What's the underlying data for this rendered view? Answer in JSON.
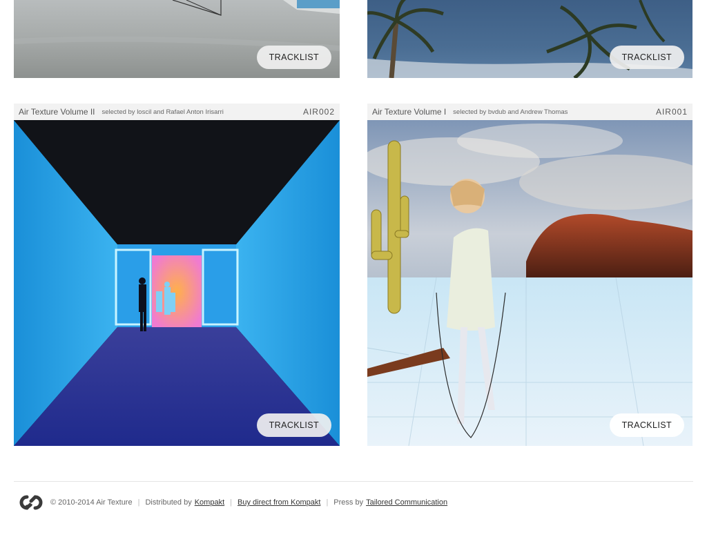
{
  "releases": [
    {
      "tracklist_label": "TRACKLIST"
    },
    {
      "tracklist_label": "TRACKLIST"
    },
    {
      "title": "Air Texture Volume II",
      "selected_by": "selected by loscil and Rafael Anton Irisarri",
      "catalog": "AIR002",
      "tracklist_label": "TRACKLIST"
    },
    {
      "title": "Air Texture Volume I",
      "selected_by": "selected by bvdub and Andrew Thomas",
      "catalog": "AIR001",
      "tracklist_label": "TRACKLIST"
    }
  ],
  "footer": {
    "copyright": "© 2010-2014 Air Texture",
    "separator": "|",
    "distributed_prefix": "Distributed by",
    "distributed_link": "Kompakt",
    "buy_link": "Buy direct from Kompakt",
    "press_prefix": "Press by",
    "press_link": "Tailored Communication"
  },
  "colors": {
    "header_bg": "#f2f2f2",
    "footer_rule": "#e4e4e4"
  },
  "icons": {
    "footer_logo": "air-texture-logo-icon"
  }
}
